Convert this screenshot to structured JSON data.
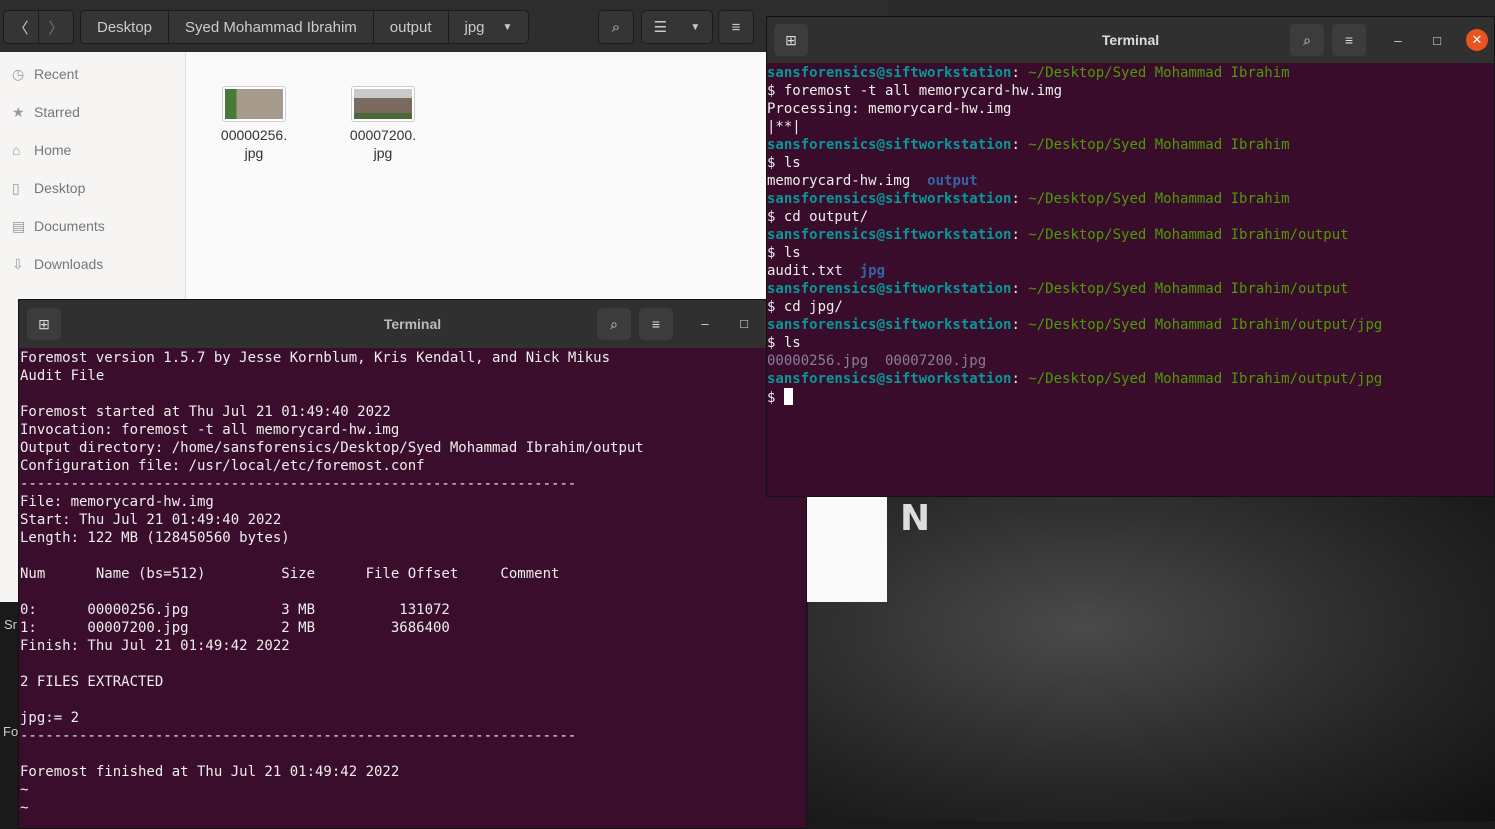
{
  "files_window": {
    "breadcrumbs": [
      "Desktop",
      "Syed Mohammad Ibrahim",
      "output",
      "jpg"
    ],
    "sidebar": [
      {
        "label": "Recent",
        "icon": "clock-icon"
      },
      {
        "label": "Starred",
        "icon": "star-icon"
      },
      {
        "label": "Home",
        "icon": "home-icon"
      },
      {
        "label": "Desktop",
        "icon": "desktop-icon"
      },
      {
        "label": "Documents",
        "icon": "document-icon"
      },
      {
        "label": "Downloads",
        "icon": "download-icon"
      }
    ],
    "files": [
      {
        "line1": "00000256.",
        "line2": "jpg"
      },
      {
        "line1": "00007200.",
        "line2": "jpg"
      }
    ]
  },
  "terminal_top": {
    "title": "Terminal",
    "prompt_user": "sansforensics@siftworkstation",
    "lines": [
      {
        "type": "prompt",
        "path": "~/Desktop/Syed Mohammad Ibrahim"
      },
      {
        "type": "text",
        "text": "$ foremost -t all memorycard-hw.img"
      },
      {
        "type": "text",
        "text": "Processing: memorycard-hw.img"
      },
      {
        "type": "text",
        "text": "|**|"
      },
      {
        "type": "prompt",
        "path": "~/Desktop/Syed Mohammad Ibrahim"
      },
      {
        "type": "text",
        "text": "$ ls"
      },
      {
        "type": "ls",
        "a": "memorycard-hw.img",
        "b": "output"
      },
      {
        "type": "prompt",
        "path": "~/Desktop/Syed Mohammad Ibrahim"
      },
      {
        "type": "text",
        "text": "$ cd output/"
      },
      {
        "type": "prompt",
        "path": "~/Desktop/Syed Mohammad Ibrahim/output"
      },
      {
        "type": "text",
        "text": "$ ls"
      },
      {
        "type": "ls",
        "a": "audit.txt",
        "b": "jpg"
      },
      {
        "type": "prompt",
        "path": "~/Desktop/Syed Mohammad Ibrahim/output"
      },
      {
        "type": "text",
        "text": "$ cd jpg/"
      },
      {
        "type": "prompt",
        "path": "~/Desktop/Syed Mohammad Ibrahim/output/jpg"
      },
      {
        "type": "text",
        "text": "$ ls"
      },
      {
        "type": "files",
        "text": "00000256.jpg  00007200.jpg"
      },
      {
        "type": "prompt",
        "path": "~/Desktop/Syed Mohammad Ibrahim/output/jpg"
      },
      {
        "type": "cursor",
        "text": "$ "
      }
    ]
  },
  "terminal_bottom": {
    "title": "Terminal",
    "lines": [
      "Foremost version 1.5.7 by Jesse Kornblum, Kris Kendall, and Nick Mikus",
      "Audit File",
      "",
      "Foremost started at Thu Jul 21 01:49:40 2022",
      "Invocation: foremost -t all memorycard-hw.img",
      "Output directory: /home/sansforensics/Desktop/Syed Mohammad Ibrahim/output",
      "Configuration file: /usr/local/etc/foremost.conf",
      "------------------------------------------------------------------",
      "File: memorycard-hw.img",
      "Start: Thu Jul 21 01:49:40 2022",
      "Length: 122 MB (128450560 bytes)",
      "",
      "Num      Name (bs=512)         Size      File Offset     Comment",
      "",
      "0:      00000256.jpg           3 MB          131072",
      "1:      00007200.jpg           2 MB         3686400",
      "Finish: Thu Jul 21 01:49:42 2022",
      "",
      "2 FILES EXTRACTED",
      "",
      "jpg:= 2",
      "------------------------------------------------------------------",
      "",
      "Foremost finished at Thu Jul 21 01:49:42 2022",
      "~",
      "~"
    ]
  },
  "background": {
    "letter": "N",
    "peek_1": "Sr",
    "peek_2": "Fo"
  }
}
